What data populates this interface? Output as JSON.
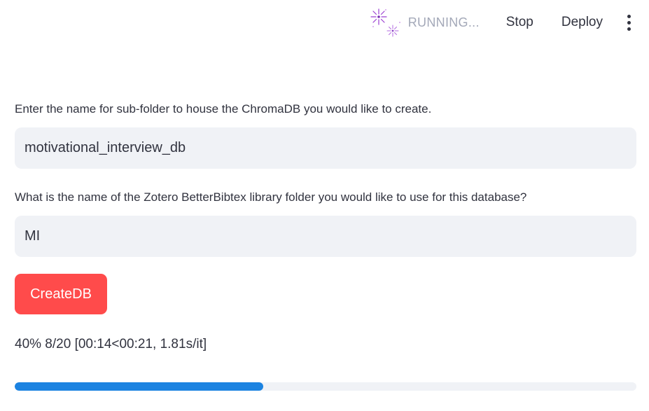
{
  "header": {
    "status_text": "RUNNING...",
    "status_icon": "running-fireworks-icon",
    "stop_label": "Stop",
    "deploy_label": "Deploy",
    "menu_icon": "kebab-menu-icon"
  },
  "form": {
    "db_folder": {
      "label": "Enter the name for sub-folder to house the ChromaDB you would like to create.",
      "value": "motivational_interview_db"
    },
    "zotero_folder": {
      "label": "What is the name of the Zotero BetterBibtex library folder you would like to use for this database?",
      "value": "MI"
    },
    "create_button_label": "CreateDB"
  },
  "progress": {
    "text": "40% 8/20 [00:14<00:21, 1.81s/it]",
    "fraction": 0.4
  },
  "colors": {
    "primary_button": "#ff4b4b",
    "progress_fill": "#1c83e1",
    "input_background": "#f0f2f6",
    "status_text": "#a3a8b8"
  }
}
